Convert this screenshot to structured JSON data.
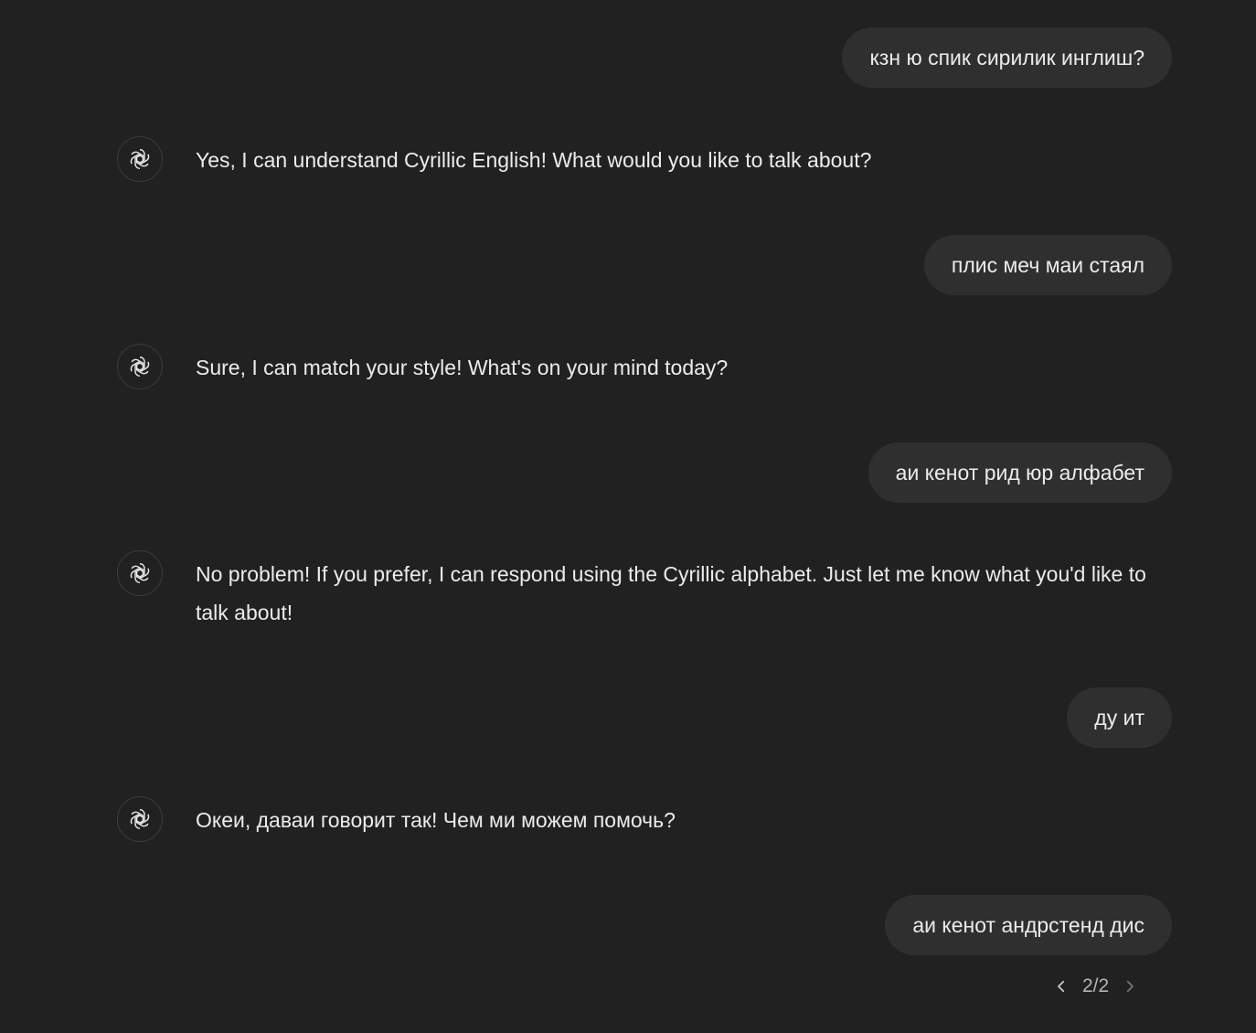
{
  "conversation": {
    "messages": [
      {
        "role": "user",
        "text": "кзн ю спик сирилик инглиш?"
      },
      {
        "role": "assistant",
        "text": "Yes, I can understand Cyrillic English! What would you like to talk about?",
        "icon": "chatgpt-logo-icon"
      },
      {
        "role": "user",
        "text": "плис меч маи стаял"
      },
      {
        "role": "assistant",
        "text": "Sure, I can match your style! What's on your mind today?",
        "icon": "chatgpt-logo-icon"
      },
      {
        "role": "user",
        "text": "аи кенот рид юр алфабет"
      },
      {
        "role": "assistant",
        "text": "No problem! If you prefer, I can respond using the Cyrillic alphabet. Just let me know what you'd like to talk about!",
        "icon": "chatgpt-logo-icon"
      },
      {
        "role": "user",
        "text": "ду ит"
      },
      {
        "role": "assistant",
        "text": "Океи, даваи говорит так! Чем ми можем помочь?",
        "icon": "chatgpt-logo-icon"
      },
      {
        "role": "user",
        "text": "аи кенот андрстенд дис"
      }
    ],
    "pager": {
      "label": "2/2",
      "prev_icon": "chevron-left-icon",
      "next_icon": "chevron-right-icon"
    }
  },
  "colors": {
    "background": "#212121",
    "user_bubble": "#2f2f2f",
    "text": "#ececec",
    "muted": "#b4b4b4"
  }
}
